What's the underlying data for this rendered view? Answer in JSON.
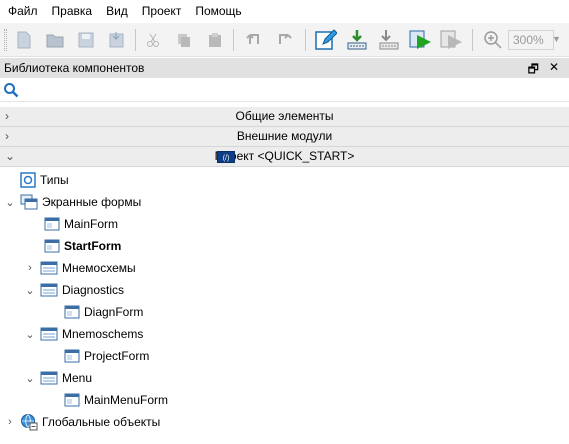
{
  "menu": [
    "Файл",
    "Правка",
    "Вид",
    "Проект",
    "Помощь"
  ],
  "toolbar": {
    "zoom_value": "300%"
  },
  "panel": {
    "title": "Библиотека компонентов",
    "pin_glyph": "🗗",
    "close_glyph": "✕"
  },
  "sections": [
    {
      "label": "Общие элементы",
      "expanded": false
    },
    {
      "label": "Внешние модули",
      "expanded": false
    },
    {
      "label": "Проект <QUICK_START>",
      "expanded": true
    }
  ],
  "tree": [
    {
      "label": "Типы",
      "icon": "types-icon",
      "expanded": null
    },
    {
      "label": "Экранные формы",
      "icon": "forms-folder-icon",
      "expanded": true
    },
    {
      "label": "MainForm",
      "icon": "form-icon",
      "expanded": null
    },
    {
      "label": "StartForm",
      "icon": "form-icon",
      "expanded": null,
      "bold": true
    },
    {
      "label": "Мнемосхемы",
      "icon": "group-icon",
      "expanded": false
    },
    {
      "label": "Diagnostics",
      "icon": "group-icon",
      "expanded": true
    },
    {
      "label": "DiagnForm",
      "icon": "form-icon",
      "expanded": null
    },
    {
      "label": "Mnemoschems",
      "icon": "group-icon",
      "expanded": true
    },
    {
      "label": "ProjectForm",
      "icon": "form-icon",
      "expanded": null
    },
    {
      "label": "Menu",
      "icon": "group-icon",
      "expanded": true
    },
    {
      "label": "MainMenuForm",
      "icon": "form-icon",
      "expanded": null
    },
    {
      "label": "Глобальные объекты",
      "icon": "globe-icon",
      "expanded": false
    }
  ]
}
